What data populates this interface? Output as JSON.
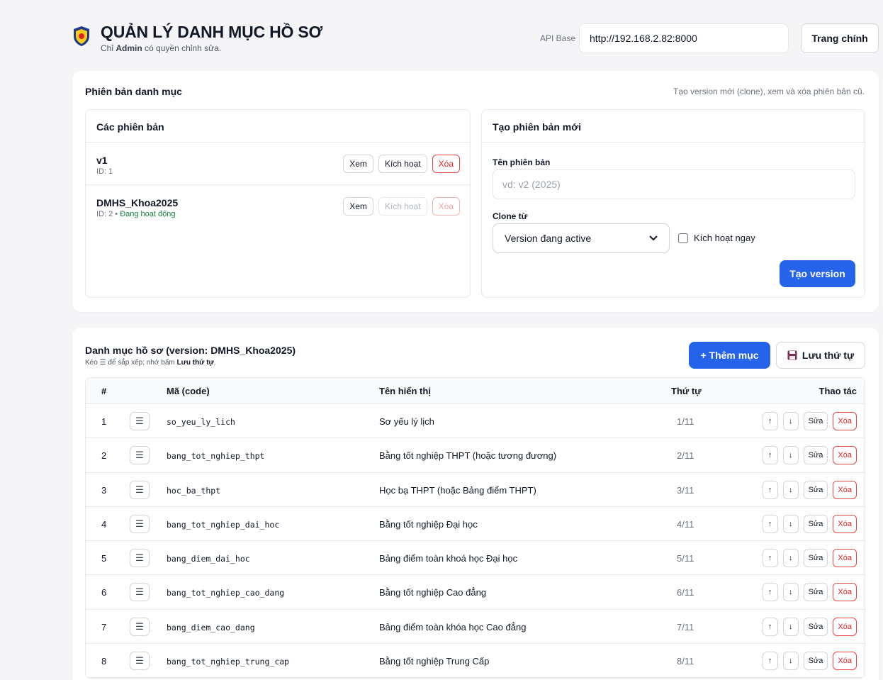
{
  "header": {
    "title": "QUẢN LÝ DANH MỤC HỒ SƠ",
    "subtitle_prefix": "Chỉ",
    "subtitle_role": "Admin",
    "subtitle_suffix": "có quyền chỉnh sửa.",
    "api_label": "API Base",
    "api_value": "http://192.168.2.82:8000",
    "home_button": "Trang chính"
  },
  "versions_card": {
    "title": "Phiên bản danh mục",
    "hint": "Tạo version mới (clone), xem và xóa phiên bản cũ.",
    "list_title": "Các phiên bản",
    "items": [
      {
        "name": "v1",
        "meta": "ID: 1",
        "status": "",
        "view": "Xem",
        "activate": "Kích hoạt",
        "delete": "Xóa"
      },
      {
        "name": "DMHS_Khoa2025",
        "meta": "ID: 2 • ",
        "status": "Đang hoạt động",
        "view": "Xem",
        "activate": "Kích hoạt",
        "delete": "Xóa"
      }
    ],
    "create": {
      "title": "Tạo phiên bản mới",
      "name_label": "Tên phiên bản",
      "name_placeholder": "vd: v2 (2025)",
      "clone_label": "Clone từ",
      "clone_value": "Version đang active",
      "activate_now": "Kích hoạt ngay",
      "submit": "Tạo version"
    }
  },
  "list_card": {
    "title": "Danh mục hồ sơ (version: DMHS_Khoa2025)",
    "sub_prefix": "Kéo ☰ để sắp xếp; nhớ bấm",
    "sub_bold": "Lưu thứ tự",
    "sub_suffix": ".",
    "add_button": "+ Thêm mục",
    "save_button": "Lưu thứ tự",
    "columns": {
      "num": "#",
      "code": "Mã (code)",
      "name": "Tên hiển thị",
      "order": "Thứ tự",
      "actions": "Thao tác"
    },
    "rows": [
      {
        "num": "1",
        "code": "so_yeu_ly_lich",
        "name": "Sơ yếu lý lịch",
        "order": "1/11"
      },
      {
        "num": "2",
        "code": "bang_tot_nghiep_thpt",
        "name": "Bằng tốt nghiệp THPT (hoặc tương đương)",
        "order": "2/11"
      },
      {
        "num": "3",
        "code": "hoc_ba_thpt",
        "name": "Học bạ THPT (hoặc Bảng điểm THPT)",
        "order": "3/11"
      },
      {
        "num": "4",
        "code": "bang_tot_nghiep_dai_hoc",
        "name": "Bằng tốt nghiệp Đại học",
        "order": "4/11"
      },
      {
        "num": "5",
        "code": "bang_diem_dai_hoc",
        "name": "Bảng điểm toàn khoá học Đại học",
        "order": "5/11"
      },
      {
        "num": "6",
        "code": "bang_tot_nghiep_cao_dang",
        "name": "Bằng tốt nghiệp Cao đẳng",
        "order": "6/11"
      },
      {
        "num": "7",
        "code": "bang_diem_cao_dang",
        "name": "Bảng điểm toàn khóa học Cao đẳng",
        "order": "7/11"
      },
      {
        "num": "8",
        "code": "bang_tot_nghiep_trung_cap",
        "name": "Bằng tốt nghiệp Trung Cấp",
        "order": "8/11"
      }
    ],
    "row_actions": {
      "up": "↑",
      "down": "↓",
      "edit": "Sửa",
      "delete": "Xóa",
      "drag": "☰"
    }
  },
  "colors": {
    "primary": "#2563eb",
    "danger": "#dc2626",
    "active_status": "#15803d"
  }
}
